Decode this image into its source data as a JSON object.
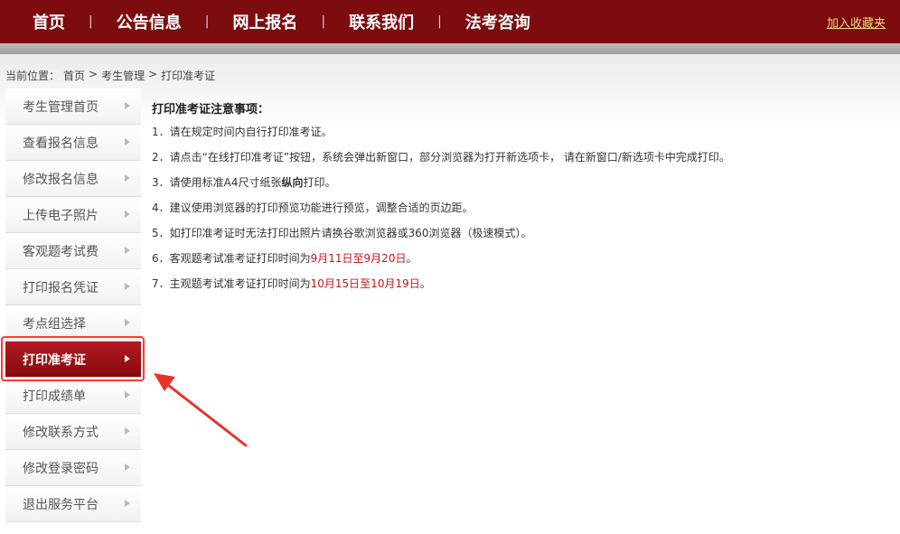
{
  "nav": {
    "items": [
      "首页",
      "公告信息",
      "网上报名",
      "联系我们",
      "法考咨询"
    ],
    "separator": "|",
    "favorite": "加入收藏夹"
  },
  "breadcrumb": {
    "label": "当前位置：",
    "home": "首页",
    "sep1": ">",
    "section": "考生管理",
    "sep2": ">",
    "current": "打印准考证"
  },
  "sidebar": {
    "items": [
      {
        "label": "考生管理首页"
      },
      {
        "label": "查看报名信息"
      },
      {
        "label": "修改报名信息"
      },
      {
        "label": "上传电子照片"
      },
      {
        "label": "客观题考试费"
      },
      {
        "label": "打印报名凭证"
      },
      {
        "label": "考点组选择"
      },
      {
        "label": "打印准考证"
      },
      {
        "label": "打印成绩单"
      },
      {
        "label": "修改联系方式"
      },
      {
        "label": "修改登录密码"
      },
      {
        "label": "退出服务平台"
      }
    ],
    "active_index": 7
  },
  "content": {
    "title": "打印准考证注意事项：",
    "items": {
      "i1": "1．请在规定时间内自行打印准考证。",
      "i2": "2．请点击“在线打印准考证”按钮，系统会弹出新窗口，部分浏览器为打开新选项卡， 请在新窗口/新选项卡中完成打印。",
      "i3a": "3．请使用标准A4尺寸纸张",
      "i3b": "纵向",
      "i3c": "打印。",
      "i4": "4．建议使用浏览器的打印预览功能进行预览，调整合适的页边距。",
      "i5": "5．如打印准考证时无法打印出照片请换谷歌浏览器或360浏览器（极速模式）。",
      "i6a": "6．客观题考试准考证打印时间为",
      "i6b": "9月11日至9月20日",
      "i6c": "。",
      "i7a": "7．主观题考试准考证打印时间为",
      "i7b": "10月15日至10月19日",
      "i7c": "。"
    }
  },
  "colors": {
    "header": "#7d0c0f",
    "active": "#a3141a",
    "highlight": "#ff3b30",
    "date_red": "#c8141a",
    "favorite": "#f2d37a"
  },
  "icons": {
    "sidebar_arrow": "triangle-right-icon",
    "callout": "red-arrow-icon"
  }
}
